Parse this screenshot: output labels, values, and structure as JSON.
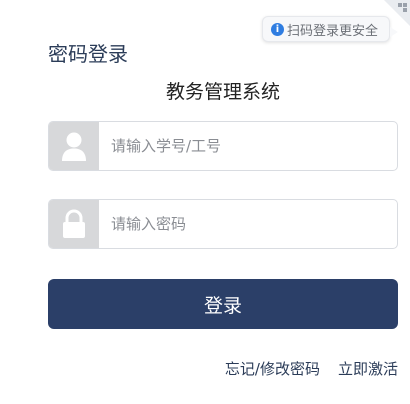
{
  "qr_hint": {
    "icon": "info-icon",
    "text": "扫码登录更安全"
  },
  "login_title": "密码登录",
  "system_title": "教务管理系统",
  "username": {
    "icon": "user-icon",
    "placeholder": "请输入学号/工号",
    "value": ""
  },
  "password": {
    "icon": "lock-icon",
    "placeholder": "请输入密码",
    "value": ""
  },
  "login_button": "登录",
  "links": {
    "forgot": "忘记/修改密码",
    "activate": "立即激活"
  },
  "colors": {
    "primary": "#2b3f68",
    "title": "#2b3c58",
    "icon_bg": "#d7d8da"
  }
}
